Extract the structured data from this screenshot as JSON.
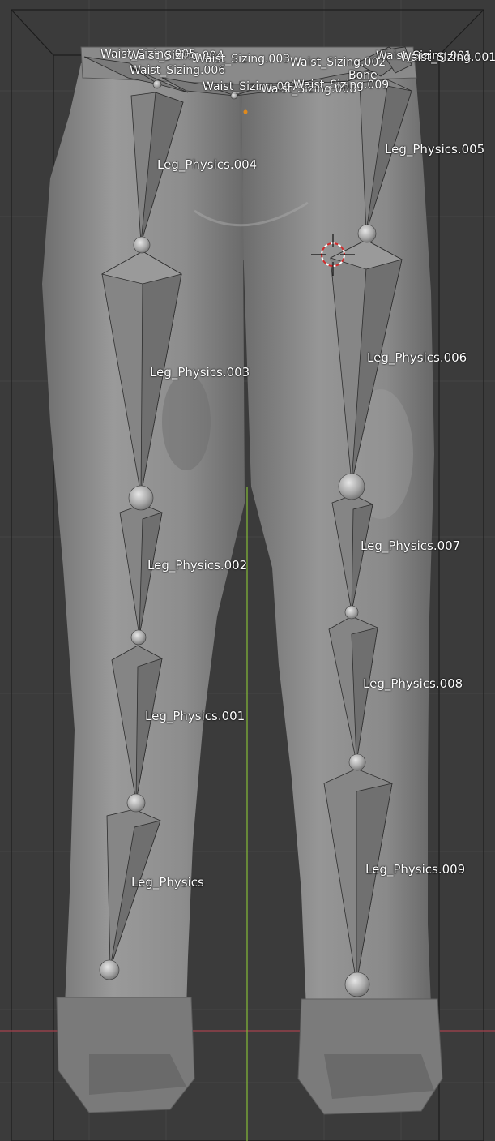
{
  "viewport": {
    "background": "#3b3b3b",
    "grid_color": "#454545",
    "x_axis_color": "#a5424d",
    "z_axis_color": "#7fb238",
    "mesh_color": "#8c8c8c",
    "bone_color": "#7e7e7e"
  },
  "bones": {
    "leg_physics": "Leg_Physics",
    "leg_physics_001": "Leg_Physics.001",
    "leg_physics_002": "Leg_Physics.002",
    "leg_physics_003": "Leg_Physics.003",
    "leg_physics_004": "Leg_Physics.004",
    "leg_physics_005": "Leg_Physics.005",
    "leg_physics_006": "Leg_Physics.006",
    "leg_physics_007": "Leg_Physics.007",
    "leg_physics_008": "Leg_Physics.008",
    "leg_physics_009": "Leg_Physics.009",
    "waist_sizing_001": "Waist_Sizing.001",
    "waist_sizing_001b": "Waist_Sizing.001",
    "waist_sizing_002": "Waist_Sizing.002",
    "waist_sizing_003": "Waist_Sizing.003",
    "waist_sizing_004": "Waist_Sizing.004",
    "waist_sizing_005": "Waist_Sizing.005",
    "waist_sizing_006": "Waist_Sizing.006",
    "waist_sizing_007": "Waist_Sizing.007",
    "waist_sizing_008": "Waist_Sizing.008",
    "waist_sizing_009": "Waist_Sizing.009",
    "bone": "Bone"
  }
}
